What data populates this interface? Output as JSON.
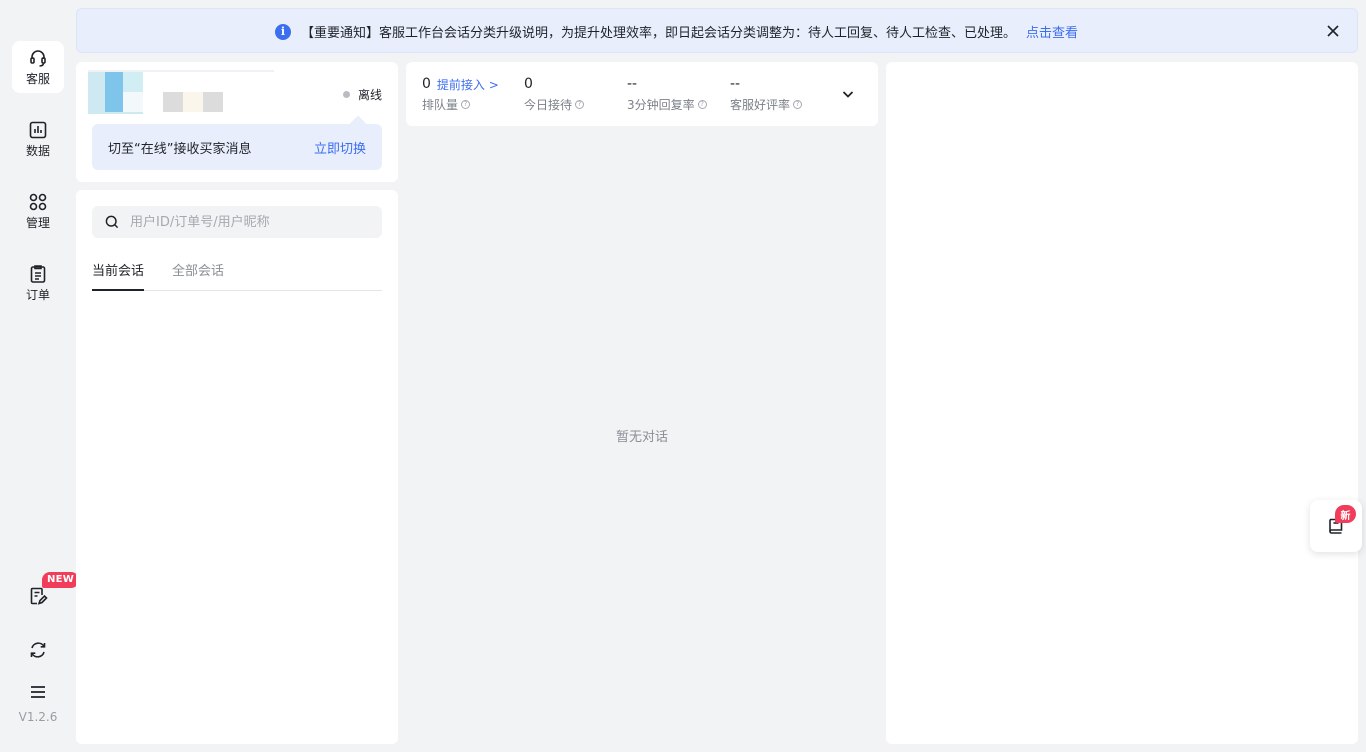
{
  "nav": {
    "items": [
      {
        "label": "客服",
        "icon": "headset-icon"
      },
      {
        "label": "数据",
        "icon": "chart-icon"
      },
      {
        "label": "管理",
        "icon": "grid-icon"
      },
      {
        "label": "订单",
        "icon": "clipboard-icon"
      }
    ],
    "tools": {
      "new_badge": "NEW",
      "note_icon": "note-edit-icon",
      "refresh_icon": "refresh-icon",
      "menu_icon": "menu-icon"
    },
    "version": "V1.2.6"
  },
  "notice": {
    "text": "【重要通知】客服工作台会话分类升级说明，为提升处理效率，即日起会话分类调整为：待人工回复、待人工检查、已处理。",
    "link": "点击查看",
    "icon": "info-icon"
  },
  "profile": {
    "status": "离线",
    "tip_text": "切至“在线”接收买家消息",
    "tip_action": "立即切换"
  },
  "conversations": {
    "search_placeholder": "用户ID/订单号/用户昵称",
    "tabs": [
      {
        "label": "当前会话",
        "active": true
      },
      {
        "label": "全部会话",
        "active": false
      }
    ]
  },
  "stats": {
    "queue": {
      "value": "0",
      "action": "提前接入 >",
      "label": "排队量"
    },
    "today": {
      "value": "0",
      "label": "今日接待"
    },
    "reply_rate": {
      "value": "--",
      "label": "3分钟回复率"
    },
    "good_rate": {
      "value": "--",
      "label": "客服好评率"
    }
  },
  "empty_text": "暂无对话",
  "float": {
    "badge": "新",
    "icon": "book-icon"
  },
  "colors": {
    "accent": "#3c6ef0",
    "badge": "#f03e5a",
    "background": "#f2f3f5"
  }
}
